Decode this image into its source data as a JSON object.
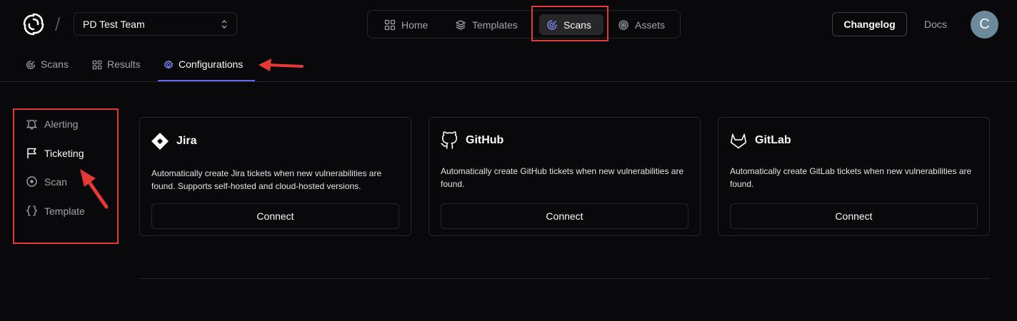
{
  "header": {
    "team_select": {
      "value": "PD Test Team"
    },
    "nav": [
      {
        "label": "Home",
        "icon": "grid-icon"
      },
      {
        "label": "Templates",
        "icon": "layers-icon"
      },
      {
        "label": "Scans",
        "icon": "radar-icon",
        "active": true
      },
      {
        "label": "Assets",
        "icon": "target-icon"
      }
    ],
    "changelog_label": "Changelog",
    "docs_label": "Docs",
    "avatar_initial": "C"
  },
  "subtabs": [
    {
      "label": "Scans",
      "icon": "radar-icon"
    },
    {
      "label": "Results",
      "icon": "results-icon"
    },
    {
      "label": "Configurations",
      "icon": "gear-icon",
      "active": true
    }
  ],
  "sidebar": {
    "items": [
      {
        "label": "Alerting",
        "icon": "bell-icon"
      },
      {
        "label": "Ticketing",
        "icon": "flag-icon",
        "active": true
      },
      {
        "label": "Scan",
        "icon": "scan-circle-icon"
      },
      {
        "label": "Template",
        "icon": "braces-icon"
      }
    ]
  },
  "integrations": [
    {
      "title": "Jira",
      "icon": "jira-icon",
      "description": "Automatically create Jira tickets when new vulnerabilities are found. Supports self-hosted and cloud-hosted versions.",
      "button": "Connect"
    },
    {
      "title": "GitHub",
      "icon": "github-icon",
      "description": "Automatically create GitHub tickets when new vulnerabilities are found.",
      "button": "Connect"
    },
    {
      "title": "GitLab",
      "icon": "gitlab-icon",
      "description": "Automatically create GitLab tickets when new vulnerabilities are found.",
      "button": "Connect"
    }
  ],
  "annotation_color": "#e53935",
  "accent_color": "#6366f1"
}
